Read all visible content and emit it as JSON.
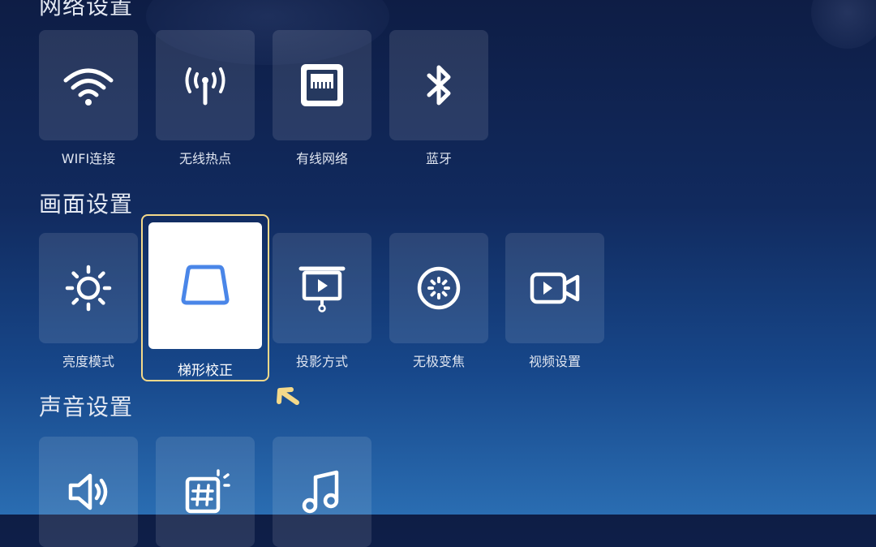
{
  "sections": {
    "network": {
      "title": "网络设置",
      "items": [
        {
          "label": "WIFI连接",
          "icon": "wifi-icon"
        },
        {
          "label": "无线热点",
          "icon": "hotspot-icon"
        },
        {
          "label": "有线网络",
          "icon": "ethernet-icon"
        },
        {
          "label": "蓝牙",
          "icon": "bluetooth-icon"
        }
      ]
    },
    "picture": {
      "title": "画面设置",
      "items": [
        {
          "label": "亮度模式",
          "icon": "brightness-icon"
        },
        {
          "label": "梯形校正",
          "icon": "keystone-icon",
          "selected": true
        },
        {
          "label": "投影方式",
          "icon": "projection-icon"
        },
        {
          "label": "无极变焦",
          "icon": "zoom-icon"
        },
        {
          "label": "视频设置",
          "icon": "video-icon"
        }
      ]
    },
    "sound": {
      "title": "声音设置",
      "items": [
        {
          "label": "",
          "icon": "speaker-icon"
        },
        {
          "label": "",
          "icon": "sound-effect-icon"
        },
        {
          "label": "",
          "icon": "music-note-icon"
        }
      ]
    }
  },
  "colors": {
    "selection_border": "#f4d98a",
    "keystone_accent": "#4a86e8",
    "pointer_arrow": "#f4d98a"
  },
  "pointer": {
    "icon": "pointer-arrow-icon"
  }
}
